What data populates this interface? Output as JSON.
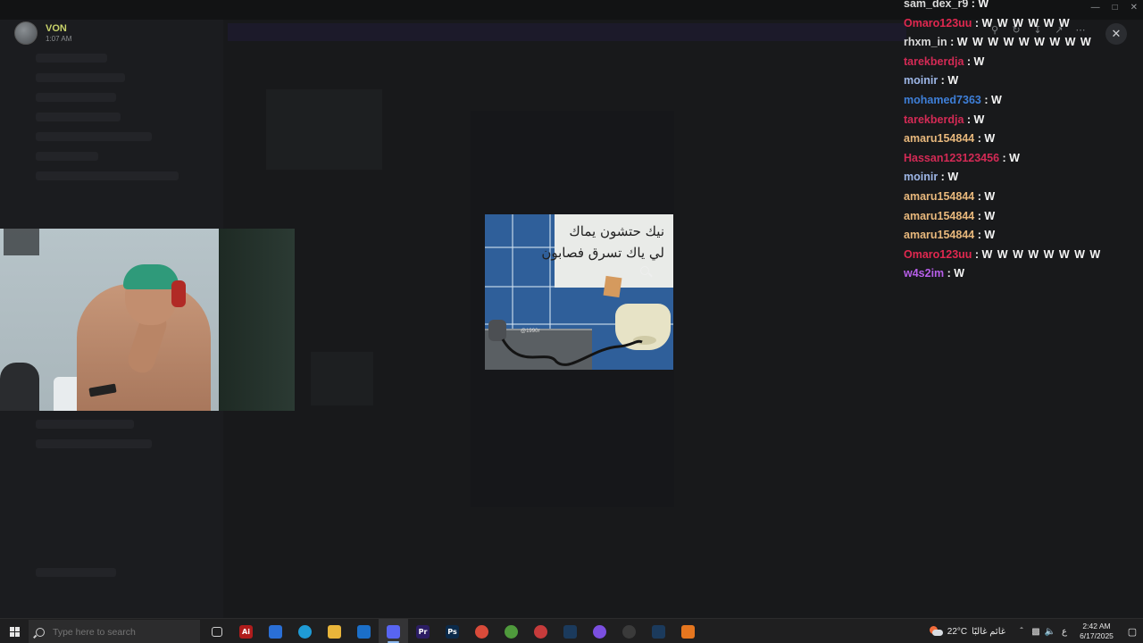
{
  "uploader": {
    "name": "VON",
    "time": "1:07 AM"
  },
  "chat": [
    {
      "user": "sam_dex_r9",
      "color": "#d9d9d9",
      "msg": "W"
    },
    {
      "user": "Omaro123uu",
      "color": "#e0284f",
      "msg": "W W W W W W"
    },
    {
      "user": "rhxm_in",
      "color": "#d9d9d9",
      "msg": "W W W W W W W W W"
    },
    {
      "user": "tarekberdja",
      "color": "#d32a55",
      "msg": "W"
    },
    {
      "user": "moinir",
      "color": "#9db6e6",
      "msg": "W"
    },
    {
      "user": "mohamed7363",
      "color": "#3e7fd8",
      "msg": "W"
    },
    {
      "user": "tarekberdja",
      "color": "#d32a55",
      "msg": "W"
    },
    {
      "user": "amaru154844",
      "color": "#e8b87c",
      "msg": "W"
    },
    {
      "user": "Hassan123123456",
      "color": "#d32a55",
      "msg": "W"
    },
    {
      "user": "moinir",
      "color": "#9db6e6",
      "msg": "W"
    },
    {
      "user": "amaru154844",
      "color": "#e8b87c",
      "msg": "W"
    },
    {
      "user": "amaru154844",
      "color": "#e8b87c",
      "msg": "W"
    },
    {
      "user": "amaru154844",
      "color": "#e8b87c",
      "msg": "W"
    },
    {
      "user": "Omaro123uu",
      "color": "#e0284f",
      "msg": "W W W W W W W W"
    },
    {
      "user": "w4s2im",
      "color": "#b65ee8",
      "msg": "W"
    }
  ],
  "meme": {
    "line1": "نيك حتشون يماك",
    "line2": "لي ياك تسرق فصابون",
    "watermark": "@1990r"
  },
  "taskbar": {
    "search_placeholder": "Type here to search",
    "apps": [
      {
        "name": "task-view",
        "label": "",
        "color": "#333"
      },
      {
        "name": "adobe-illustrator",
        "label": "Ai",
        "color": "#b01c1c"
      },
      {
        "name": "microsoft-store",
        "label": "",
        "color": "#2a6fd6"
      },
      {
        "name": "edge",
        "label": "",
        "color": "#1f9bd6"
      },
      {
        "name": "file-explorer",
        "label": "",
        "color": "#e9b53a"
      },
      {
        "name": "outlook",
        "label": "",
        "color": "#1b6fc9"
      },
      {
        "name": "discord",
        "label": "",
        "color": "#5865f2"
      },
      {
        "name": "premiere",
        "label": "Pr",
        "color": "#2b1d63"
      },
      {
        "name": "photoshop",
        "label": "Ps",
        "color": "#0b2a4a"
      },
      {
        "name": "chrome",
        "label": "",
        "color": "#d94b3a"
      },
      {
        "name": "app-green",
        "label": "",
        "color": "#4f9a3c"
      },
      {
        "name": "app-red",
        "label": "",
        "color": "#c63b3b"
      },
      {
        "name": "steam",
        "label": "",
        "color": "#1b3a5c"
      },
      {
        "name": "messenger",
        "label": "",
        "color": "#7b4fe0"
      },
      {
        "name": "app-circle",
        "label": "",
        "color": "#3a3a3a"
      },
      {
        "name": "steam-2",
        "label": "",
        "color": "#1b3a5c"
      },
      {
        "name": "app-orange",
        "label": "",
        "color": "#e5761f"
      }
    ],
    "weather_temp": "22°C",
    "weather_text": "غائم غالبًا",
    "lang": "ع",
    "time": "2:42 AM",
    "date": "6/17/2025"
  }
}
